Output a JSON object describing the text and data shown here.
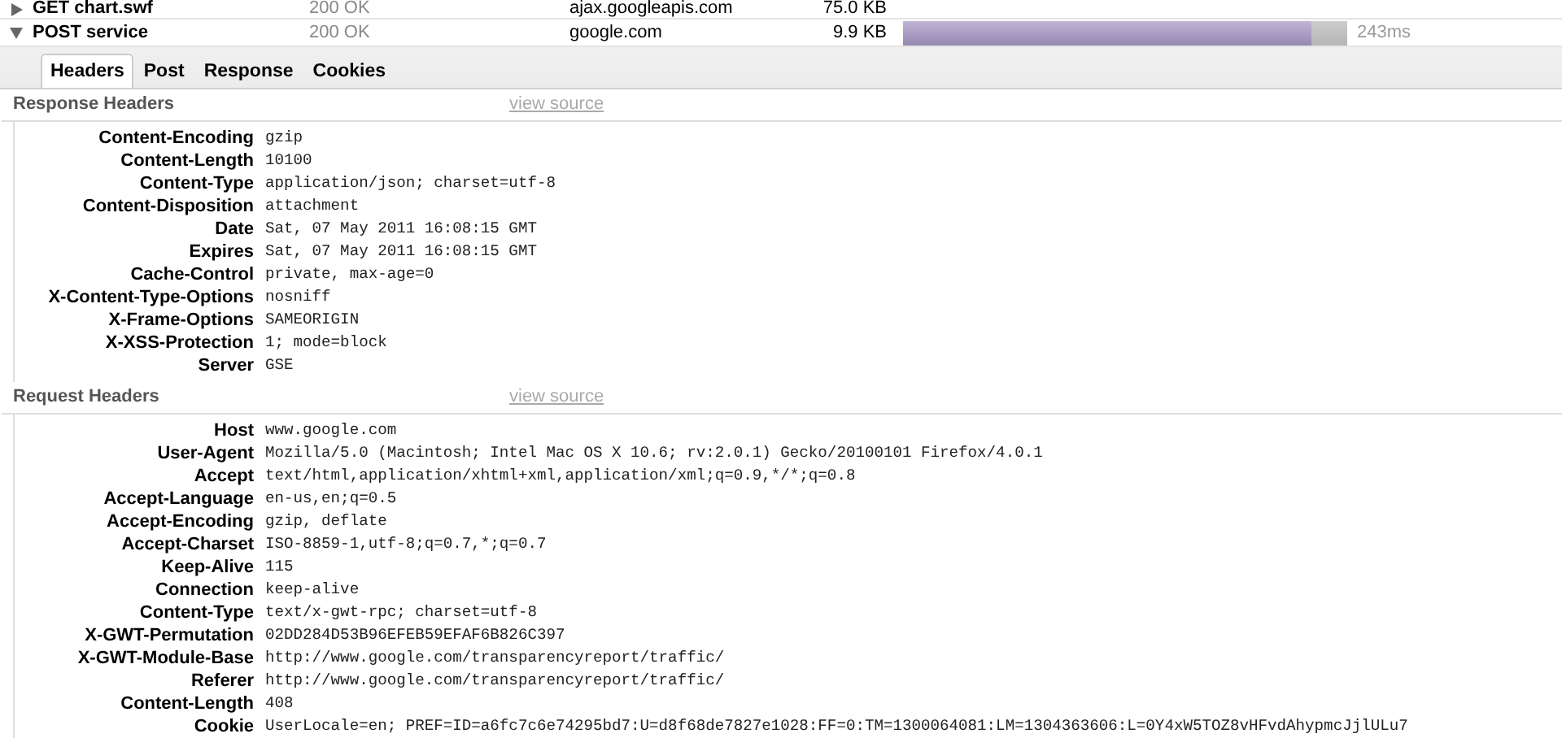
{
  "requests": [
    {
      "method_url": "GET chart.swf",
      "status": "200 OK",
      "domain": "ajax.googleapis.com",
      "size": "75.0 KB",
      "expanded": false
    },
    {
      "method_url": "POST service",
      "status": "200 OK",
      "domain": "google.com",
      "size": "9.9 KB",
      "expanded": true,
      "timing": {
        "level": 0.92
      },
      "time": "243ms"
    }
  ],
  "tabs": [
    {
      "label": "Headers",
      "selected": true
    },
    {
      "label": "Post",
      "selected": false
    },
    {
      "label": "Response",
      "selected": false
    },
    {
      "label": "Cookies",
      "selected": false
    }
  ],
  "sections": [
    {
      "title": "Response Headers",
      "link": "view source",
      "headers": [
        {
          "name": "Content-Encoding",
          "value": "gzip"
        },
        {
          "name": "Content-Length",
          "value": "10100"
        },
        {
          "name": "Content-Type",
          "value": "application/json; charset=utf-8"
        },
        {
          "name": "Content-Disposition",
          "value": "attachment"
        },
        {
          "name": "Date",
          "value": "Sat, 07 May 2011 16:08:15 GMT"
        },
        {
          "name": "Expires",
          "value": "Sat, 07 May 2011 16:08:15 GMT"
        },
        {
          "name": "Cache-Control",
          "value": "private, max-age=0"
        },
        {
          "name": "X-Content-Type-Options",
          "value": "nosniff"
        },
        {
          "name": "X-Frame-Options",
          "value": "SAMEORIGIN"
        },
        {
          "name": "X-XSS-Protection",
          "value": "1; mode=block"
        },
        {
          "name": "Server",
          "value": "GSE"
        }
      ]
    },
    {
      "title": "Request Headers",
      "link": "view source",
      "headers": [
        {
          "name": "Host",
          "value": "www.google.com"
        },
        {
          "name": "User-Agent",
          "value": "Mozilla/5.0 (Macintosh; Intel Mac OS X 10.6; rv:2.0.1) Gecko/20100101 Firefox/4.0.1"
        },
        {
          "name": "Accept",
          "value": "text/html,application/xhtml+xml,application/xml;q=0.9,*/*;q=0.8"
        },
        {
          "name": "Accept-Language",
          "value": "en-us,en;q=0.5"
        },
        {
          "name": "Accept-Encoding",
          "value": "gzip, deflate"
        },
        {
          "name": "Accept-Charset",
          "value": "ISO-8859-1,utf-8;q=0.7,*;q=0.7"
        },
        {
          "name": "Keep-Alive",
          "value": "115"
        },
        {
          "name": "Connection",
          "value": "keep-alive"
        },
        {
          "name": "Content-Type",
          "value": "text/x-gwt-rpc; charset=utf-8"
        },
        {
          "name": "X-GWT-Permutation",
          "value": "02DD284D53B96EFEB59EFAF6B826C397"
        },
        {
          "name": "X-GWT-Module-Base",
          "value": "http://www.google.com/transparencyreport/traffic/"
        },
        {
          "name": "Referer",
          "value": "http://www.google.com/transparencyreport/traffic/"
        },
        {
          "name": "Content-Length",
          "value": "408"
        },
        {
          "name": "Cookie",
          "value": "UserLocale=en; PREF=ID=a6fc7c6e74295bd7:U=d8f68de7827e1028:FF=0:TM=1300064081:LM=1304363606:L=0Y4xW5TOZ8vHFvdAhypmcJjlULu7"
        }
      ]
    }
  ]
}
